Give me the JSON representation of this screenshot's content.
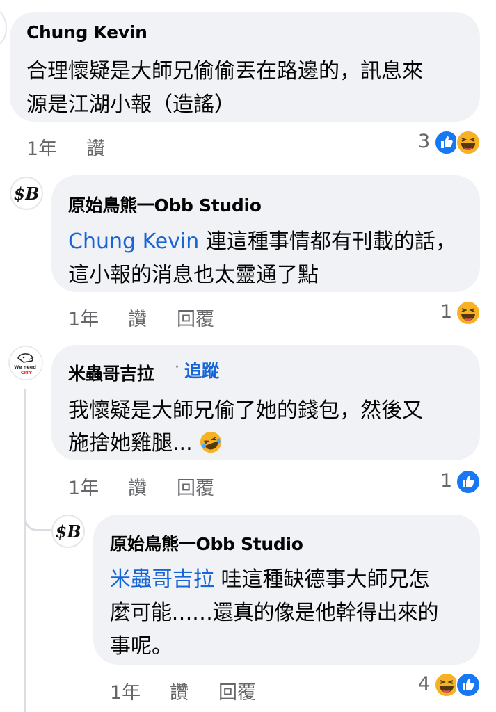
{
  "comments": [
    {
      "author": "Chung Kevin",
      "lines": [
        "合理懷疑是大師兄偷偷丟在路邊的，訊息來",
        "源是江湖小報（造謠）"
      ],
      "time": "1年",
      "like": "讚",
      "reactions": {
        "count": "3",
        "icons": [
          "like-icon",
          "haha-icon"
        ]
      }
    },
    {
      "author": "原始鳥熊一Obb Studio",
      "mention": "Chung Kevin",
      "lines": [
        " 連這種事情都有刊載的話，",
        "這小報的消息也太靈通了點"
      ],
      "time": "1年",
      "like": "讚",
      "reply": "回覆",
      "reactions": {
        "count": "1",
        "icons": [
          "haha-icon"
        ]
      }
    },
    {
      "author": "米蟲哥吉拉",
      "separator": "·",
      "follow": "追蹤",
      "lines": [
        "我懷疑是大師兄偷了她的錢包，然後又",
        "施捨她雞腿..."
      ],
      "time": "1年",
      "like": "讚",
      "reply": "回覆",
      "reactions": {
        "count": "1",
        "icons": [
          "like-icon"
        ]
      }
    },
    {
      "author": "原始鳥熊一Obb Studio",
      "mention": "米蟲哥吉拉",
      "lines": [
        " 哇這種缺德事大師兄怎",
        "麼可能……還真的像是他幹得出來的",
        "事呢。"
      ],
      "time": "1年",
      "like": "讚",
      "reply": "回覆",
      "reactions": {
        "count": "4",
        "icons": [
          "haha-icon",
          "like-icon"
        ]
      }
    }
  ],
  "avatar_badge_text": [
    "We need",
    "CITY"
  ],
  "colors": {
    "bubble": "#f0f2f5",
    "mention": "#1866d6",
    "meta": "#65676b",
    "like_blue": "#1877f2",
    "haha_yellow": "#f7b125"
  }
}
